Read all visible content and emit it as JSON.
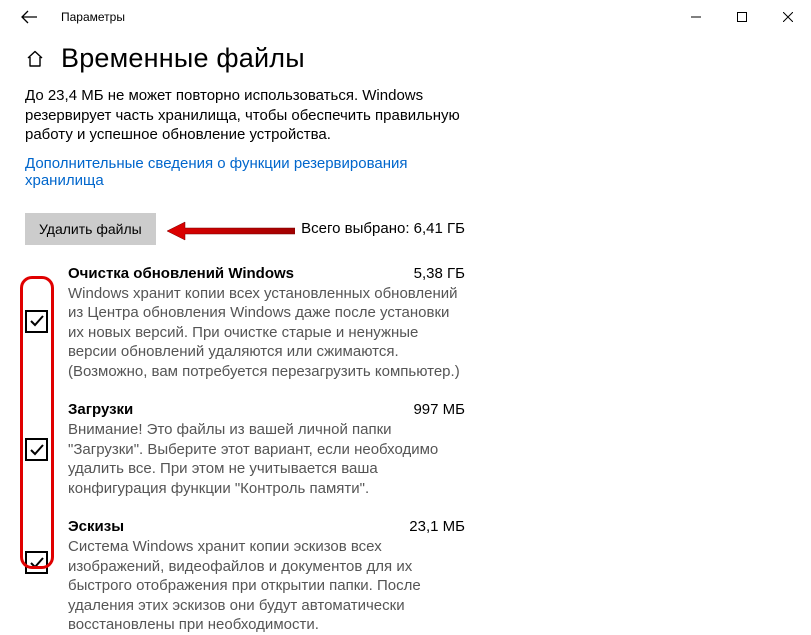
{
  "window": {
    "title": "Параметры"
  },
  "page": {
    "title": "Временные файлы",
    "desc": "До 23,4 МБ не может повторно использоваться. Windows резервирует часть хранилища, чтобы обеспечить правильную работу и успешное обновление устройства.",
    "link": "Дополнительные сведения о функции резервирования хранилища",
    "delete_btn": "Удалить файлы",
    "total_prefix": "Всего выбрано: ",
    "total_value": "6,41 ГБ"
  },
  "items": [
    {
      "title": "Очистка обновлений Windows",
      "size": "5,38 ГБ",
      "desc": "Windows хранит копии всех установленных обновлений из Центра обновления Windows даже после установки их новых версий. При очистке старые и ненужные версии обновлений удаляются или сжимаются. (Возможно, вам потребуется перезагрузить компьютер.)",
      "checked": true
    },
    {
      "title": "Загрузки",
      "size": "997 МБ",
      "desc": "Внимание! Это файлы из вашей личной папки \"Загрузки\". Выберите этот вариант, если необходимо удалить все. При этом не учитывается ваша конфигурация функции \"Контроль памяти\".",
      "checked": true
    },
    {
      "title": "Эскизы",
      "size": "23,1 МБ",
      "desc": "Система Windows хранит копии эскизов всех изображений, видеофайлов и документов для их быстрого отображения при открытии папки. После удаления этих эскизов они будут автоматически восстановлены при необходимости.",
      "checked": true
    }
  ]
}
